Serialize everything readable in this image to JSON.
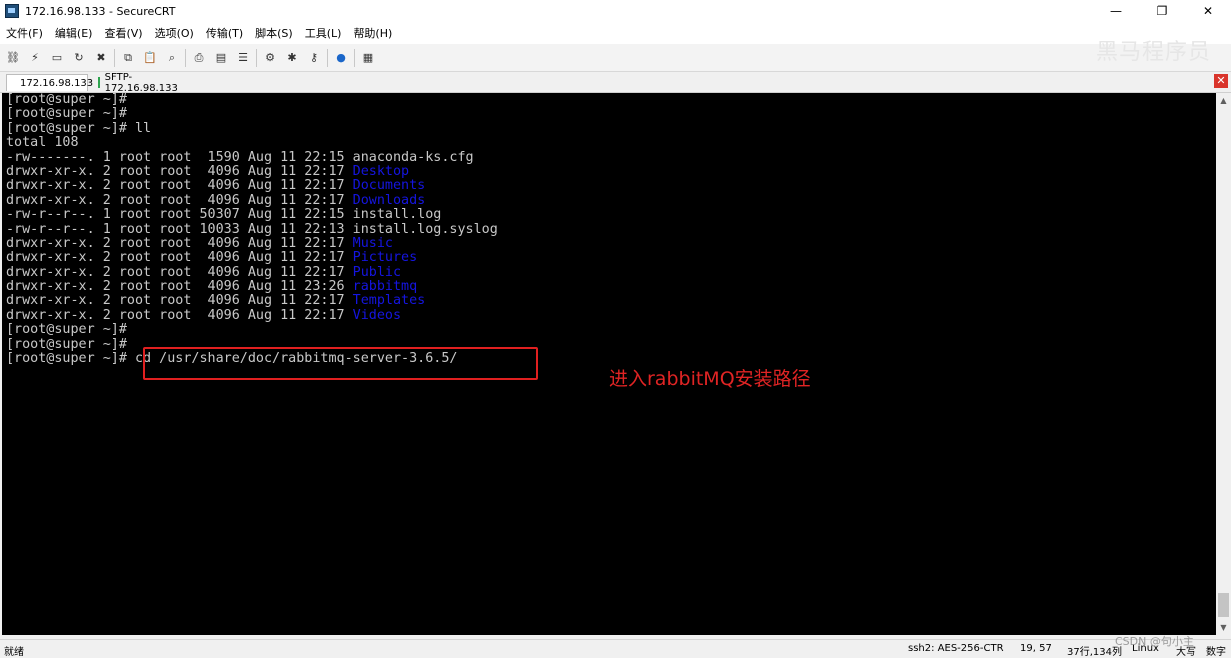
{
  "window": {
    "title": "172.16.98.133 - SecureCRT",
    "minimize": "—",
    "restore": "❐",
    "close": "✕"
  },
  "menu": [
    "文件(F)",
    "编辑(E)",
    "查看(V)",
    "选项(O)",
    "传输(T)",
    "脚本(S)",
    "工具(L)",
    "帮助(H)"
  ],
  "toolbar_icons": [
    "connect-icon",
    "quick-connect-icon",
    "connect-tab-icon",
    "reconnect-icon",
    "disconnect-icon",
    "copy-icon",
    "paste-icon",
    "find-icon",
    "print-icon",
    "print-setup-icon",
    "log-icon",
    "settings-icon",
    "keymap-icon",
    "key-icon",
    "help-icon",
    "screen-icon"
  ],
  "watermark": "黑马程序员",
  "tabs": [
    {
      "label": "172.16.98.133"
    },
    {
      "label": "SFTP-172.16.98.133"
    }
  ],
  "terminal": {
    "lines": [
      [
        {
          "t": "[root@super ~]#"
        }
      ],
      [
        {
          "t": "[root@super ~]#"
        }
      ],
      [
        {
          "t": "[root@super ~]# ll"
        }
      ],
      [
        {
          "t": "total 108"
        }
      ],
      [
        {
          "t": "-rw-------. 1 root root  1590 Aug 11 22:15 anaconda-ks.cfg"
        }
      ],
      [
        {
          "t": "drwxr-xr-x. 2 root root  4096 Aug 11 22:17 "
        },
        {
          "t": "Desktop",
          "c": "blue"
        }
      ],
      [
        {
          "t": "drwxr-xr-x. 2 root root  4096 Aug 11 22:17 "
        },
        {
          "t": "Documents",
          "c": "blue"
        }
      ],
      [
        {
          "t": "drwxr-xr-x. 2 root root  4096 Aug 11 22:17 "
        },
        {
          "t": "Downloads",
          "c": "blue"
        }
      ],
      [
        {
          "t": "-rw-r--r--. 1 root root 50307 Aug 11 22:15 install.log"
        }
      ],
      [
        {
          "t": "-rw-r--r--. 1 root root 10033 Aug 11 22:13 install.log.syslog"
        }
      ],
      [
        {
          "t": "drwxr-xr-x. 2 root root  4096 Aug 11 22:17 "
        },
        {
          "t": "Music",
          "c": "blue"
        }
      ],
      [
        {
          "t": "drwxr-xr-x. 2 root root  4096 Aug 11 22:17 "
        },
        {
          "t": "Pictures",
          "c": "blue"
        }
      ],
      [
        {
          "t": "drwxr-xr-x. 2 root root  4096 Aug 11 22:17 "
        },
        {
          "t": "Public",
          "c": "blue"
        }
      ],
      [
        {
          "t": "drwxr-xr-x. 2 root root  4096 Aug 11 23:26 "
        },
        {
          "t": "rabbitmq",
          "c": "blue"
        }
      ],
      [
        {
          "t": "drwxr-xr-x. 2 root root  4096 Aug 11 22:17 "
        },
        {
          "t": "Templates",
          "c": "blue"
        }
      ],
      [
        {
          "t": "drwxr-xr-x. 2 root root  4096 Aug 11 22:17 "
        },
        {
          "t": "Videos",
          "c": "blue"
        }
      ],
      [
        {
          "t": "[root@super ~]#"
        }
      ],
      [
        {
          "t": "[root@super ~]#"
        }
      ],
      [
        {
          "t": "[root@super ~]# cd /usr/share/doc/rabbitmq-server-3.6.5/"
        }
      ]
    ]
  },
  "annotation": "进入rabbitMQ安装路径",
  "scroll": {
    "up": "▲",
    "down": "▼"
  },
  "status": {
    "ready": "就绪",
    "cipher": "ssh2: AES-256-CTR",
    "cursor": "19,  57",
    "size": "37行,134列",
    "os": "Linux",
    "caps": "大写",
    "num": "数字"
  },
  "csdn": "CSDN @句小主"
}
